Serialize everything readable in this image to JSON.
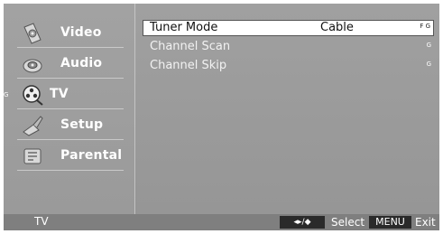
{
  "left_menu": {
    "items": [
      {
        "label": "Video",
        "icon": "video-icon"
      },
      {
        "label": "Audio",
        "icon": "audio-icon"
      },
      {
        "label": "TV",
        "icon": "tv-icon",
        "active": true,
        "marker": "G"
      },
      {
        "label": "Setup",
        "icon": "setup-icon"
      },
      {
        "label": "Parental",
        "icon": "parental-icon"
      }
    ]
  },
  "settings": {
    "rows": [
      {
        "label": "Tuner Mode",
        "value": "Cable",
        "marks": "F G",
        "selected": true
      },
      {
        "label": "Channel Scan",
        "value": "",
        "marks": "G"
      },
      {
        "label": "Channel Skip",
        "value": "",
        "marks": "G"
      }
    ]
  },
  "footer": {
    "context": "TV",
    "nav_key": "◂▸/◆",
    "select_label": "Select",
    "menu_key": "MENU",
    "exit_label": "Exit"
  }
}
